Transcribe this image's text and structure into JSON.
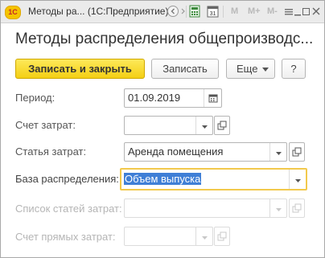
{
  "window": {
    "title": "Методы ра...  (1С:Предприятие)",
    "logo": "1С",
    "toolbar_buttons": [
      "M",
      "M+",
      "M-"
    ],
    "icons": [
      "back-icon",
      "forward-icon",
      "calculator-icon",
      "calendar-icon",
      "menu-icon",
      "minimize-icon",
      "maximize-icon",
      "close-icon"
    ]
  },
  "heading": "Методы распределения общепроизводс...",
  "actions": {
    "save_close": "Записать и закрыть",
    "save": "Записать",
    "more": "Еще",
    "help": "?"
  },
  "form": {
    "period": {
      "label": "Период:",
      "value": "01.09.2019"
    },
    "cost_account": {
      "label": "Счет затрат:",
      "value": ""
    },
    "cost_item": {
      "label": "Статья затрат:",
      "value": "Аренда помещения"
    },
    "distribution_base": {
      "label": "База распределения:",
      "value": "Объем выпуска"
    },
    "cost_items_list": {
      "label": "Список статей затрат:",
      "value": ""
    },
    "direct_cost_account": {
      "label": "Счет прямых затрат:",
      "value": ""
    }
  },
  "colors": {
    "accent": "#f4cf14",
    "focus": "#f2c94c",
    "selection": "#3f7fd6"
  }
}
